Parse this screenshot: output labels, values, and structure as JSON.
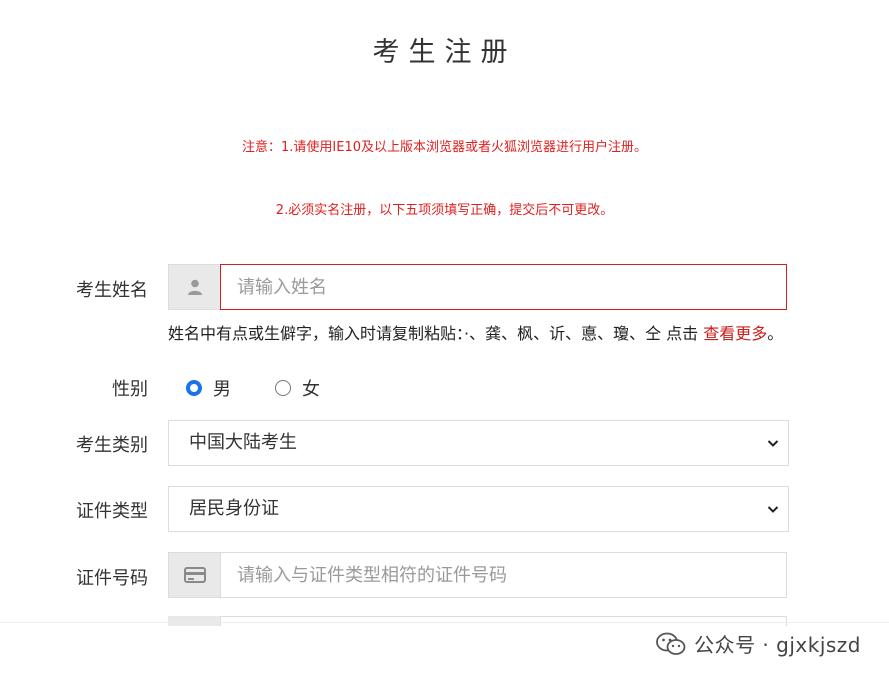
{
  "page": {
    "title": "考生注册",
    "notices": [
      "注意：1.请使用IE10及以上版本浏览器或者火狐浏览器进行用户注册。",
      "2.必须实名注册，以下五项须填写正确，提交后不可更改。"
    ]
  },
  "form": {
    "name": {
      "label": "考生姓名",
      "placeholder": "请输入姓名",
      "icon": "user-icon",
      "hint_text": "姓名中有点或生僻字，输入时请复制粘贴：·、龚、枫、䜣、悳、瓊、仝 点击",
      "hint_link": "查看更多",
      "hint_end": "。"
    },
    "gender": {
      "label": "性别",
      "options": [
        "男",
        "女"
      ],
      "selected": "男"
    },
    "category": {
      "label": "考生类别",
      "value": "中国大陆考生"
    },
    "id_type": {
      "label": "证件类型",
      "value": "居民身份证"
    },
    "id_number": {
      "label": "证件号码",
      "placeholder": "请输入与证件类型相符的证件号码",
      "icon": "id-card-icon"
    }
  },
  "watermark": {
    "text": "公众号 · gjxkjszd"
  },
  "colors": {
    "notice": "#e02020",
    "error_border": "#d02020",
    "radio_selected": "#1a73e8",
    "link": "#c81e1e"
  }
}
